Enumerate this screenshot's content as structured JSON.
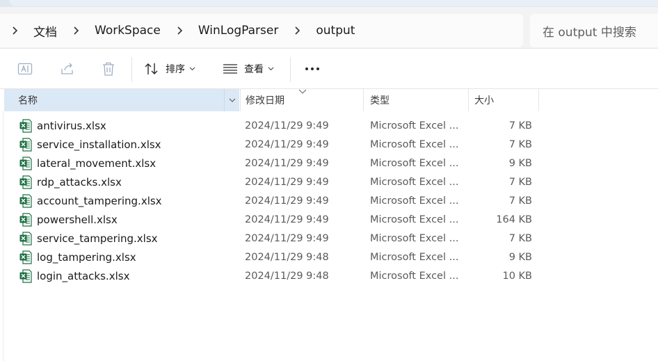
{
  "breadcrumb": {
    "items": [
      "文档",
      "WorkSpace",
      "WinLogParser",
      "output"
    ]
  },
  "search": {
    "placeholder": "在 output 中搜索"
  },
  "toolbar": {
    "sort_label": "排序",
    "view_label": "查看"
  },
  "columns": {
    "name": "名称",
    "date": "修改日期",
    "type": "类型",
    "size": "大小"
  },
  "files": [
    {
      "name": "antivirus.xlsx",
      "date": "2024/11/29 9:49",
      "type": "Microsoft Excel ...",
      "size": "7 KB"
    },
    {
      "name": "service_installation.xlsx",
      "date": "2024/11/29 9:49",
      "type": "Microsoft Excel ...",
      "size": "7 KB"
    },
    {
      "name": "lateral_movement.xlsx",
      "date": "2024/11/29 9:49",
      "type": "Microsoft Excel ...",
      "size": "9 KB"
    },
    {
      "name": "rdp_attacks.xlsx",
      "date": "2024/11/29 9:49",
      "type": "Microsoft Excel ...",
      "size": "7 KB"
    },
    {
      "name": "account_tampering.xlsx",
      "date": "2024/11/29 9:49",
      "type": "Microsoft Excel ...",
      "size": "7 KB"
    },
    {
      "name": "powershell.xlsx",
      "date": "2024/11/29 9:49",
      "type": "Microsoft Excel ...",
      "size": "164 KB"
    },
    {
      "name": "service_tampering.xlsx",
      "date": "2024/11/29 9:49",
      "type": "Microsoft Excel ...",
      "size": "7 KB"
    },
    {
      "name": "log_tampering.xlsx",
      "date": "2024/11/29 9:48",
      "type": "Microsoft Excel ...",
      "size": "9 KB"
    },
    {
      "name": "login_attacks.xlsx",
      "date": "2024/11/29 9:48",
      "type": "Microsoft Excel ...",
      "size": "10 KB"
    }
  ],
  "icons": {
    "file": "excel-file-icon",
    "chevron": "chevron-right-icon"
  },
  "colors": {
    "excel_green": "#1d7044",
    "header_selected": "#dbe8f5"
  }
}
